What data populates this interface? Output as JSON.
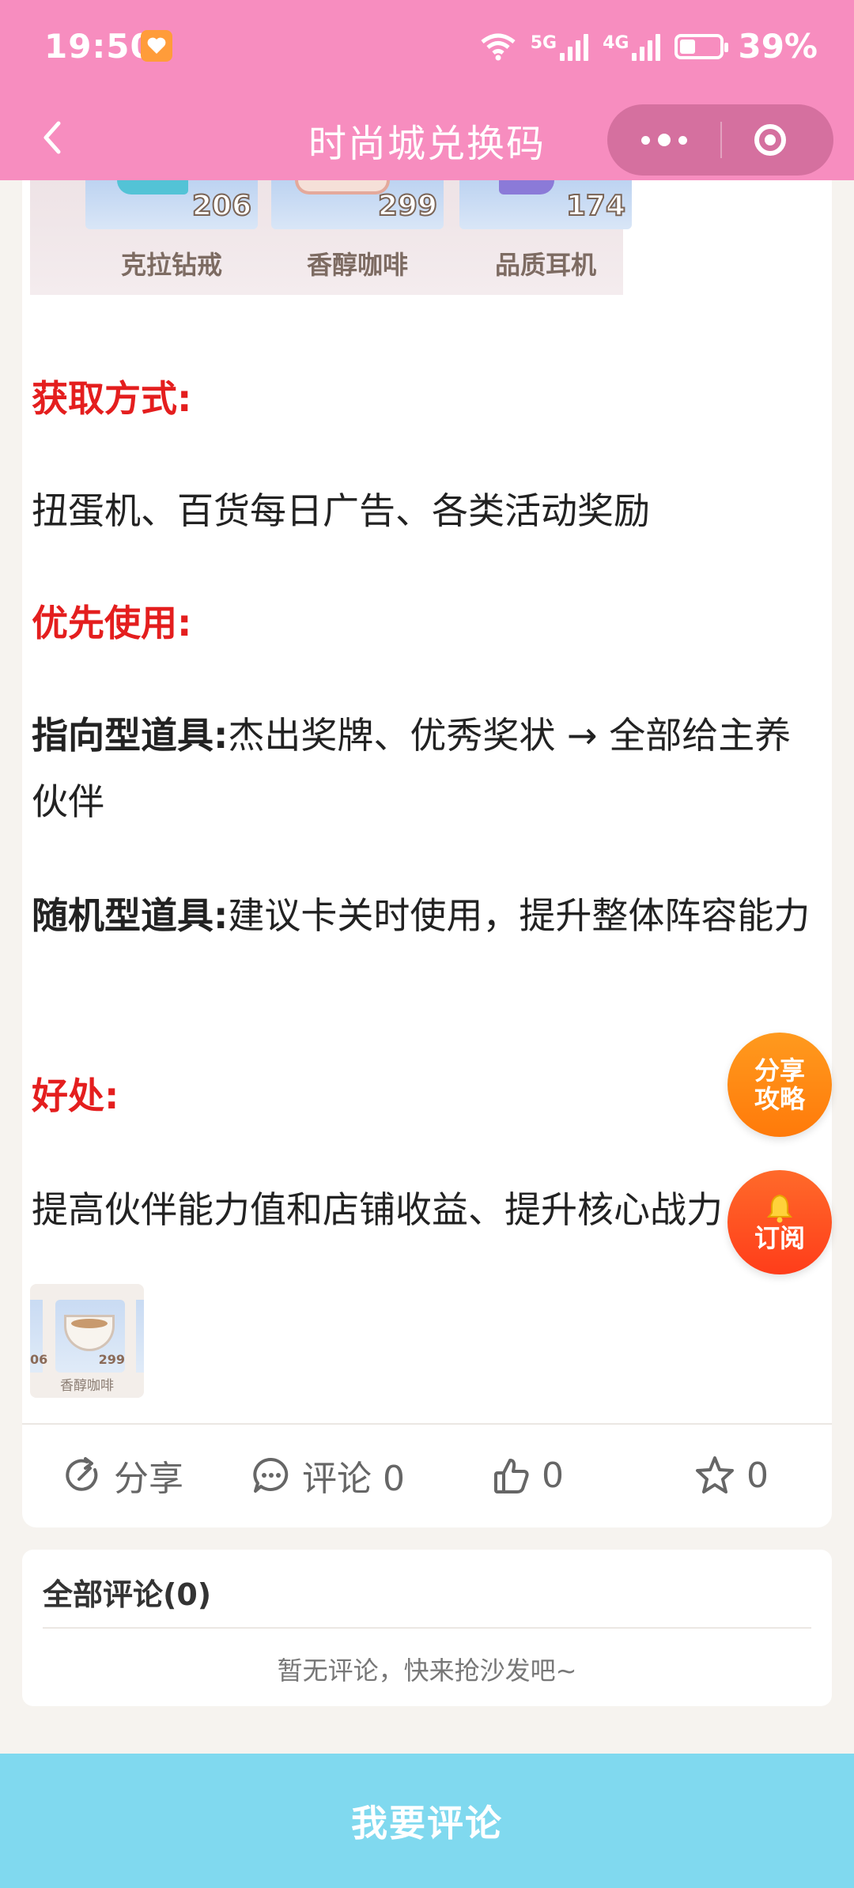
{
  "status_bar": {
    "time": "19:50",
    "network_5g": "5G",
    "network_4g": "4G",
    "battery": "39%",
    "battery_level": 0.39
  },
  "title_bar": {
    "title": "时尚城兑换码"
  },
  "article": {
    "items": [
      {
        "name": "克拉钻戒",
        "count": "206"
      },
      {
        "name": "香醇咖啡",
        "count": "299"
      },
      {
        "name": "品质耳机",
        "count": "174"
      }
    ],
    "heading_obtain": "获取方式:",
    "obtain_text": "扭蛋机、百货每日广告、各类活动奖励",
    "heading_priority": "优先使用:",
    "directed_label": "指向型道具:",
    "directed_text": "杰出奖牌、优秀奖状 → 全部给主养伙伴",
    "random_label": "随机型道具:",
    "random_text": "建议卡关时使用，提升整体阵容能力",
    "heading_benefit": "好处:",
    "benefit_text": "提高伙伴能力值和店铺收益、提升核心战力",
    "thumb": {
      "left_num": "06",
      "count": "299",
      "name": "香醇咖啡"
    }
  },
  "actions": {
    "share": "分享",
    "comment": "评论 0",
    "like": "0",
    "favorite": "0"
  },
  "comments": {
    "title": "全部评论(0)",
    "empty": "暂无评论，快来抢沙发吧~"
  },
  "floating": {
    "share_line1": "分享",
    "share_line2": "攻略",
    "subscribe": "订阅"
  },
  "bottom_button": "我要评论"
}
